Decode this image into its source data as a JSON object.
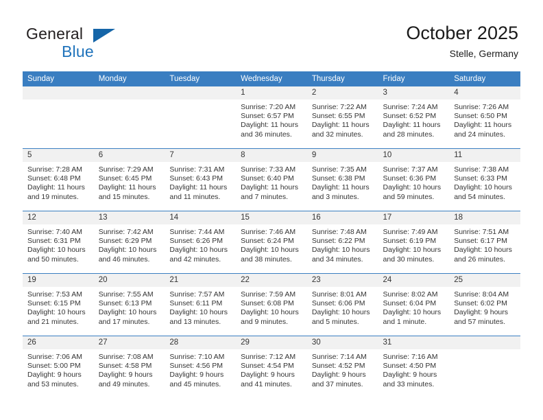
{
  "brand": {
    "name_part1": "General",
    "name_part2": "Blue",
    "triangle_color": "#1565a8",
    "blue_color": "#1f73bb"
  },
  "header": {
    "title": "October 2025",
    "subtitle": "Stelle, Germany"
  },
  "colors": {
    "header_blue": "#3a7ec1",
    "daynum_band": "#f1f1f1",
    "text": "#333333"
  },
  "weekdays": [
    "Sunday",
    "Monday",
    "Tuesday",
    "Wednesday",
    "Thursday",
    "Friday",
    "Saturday"
  ],
  "labels": {
    "sunrise_prefix": "Sunrise:",
    "sunset_prefix": "Sunset:",
    "daylight_prefix": "Daylight:"
  },
  "weeks": [
    [
      {
        "day": "",
        "empty": true
      },
      {
        "day": "",
        "empty": true
      },
      {
        "day": "",
        "empty": true
      },
      {
        "day": "1",
        "sunrise": "Sunrise: 7:20 AM",
        "sunset": "Sunset: 6:57 PM",
        "daylight": "Daylight: 11 hours and 36 minutes."
      },
      {
        "day": "2",
        "sunrise": "Sunrise: 7:22 AM",
        "sunset": "Sunset: 6:55 PM",
        "daylight": "Daylight: 11 hours and 32 minutes."
      },
      {
        "day": "3",
        "sunrise": "Sunrise: 7:24 AM",
        "sunset": "Sunset: 6:52 PM",
        "daylight": "Daylight: 11 hours and 28 minutes."
      },
      {
        "day": "4",
        "sunrise": "Sunrise: 7:26 AM",
        "sunset": "Sunset: 6:50 PM",
        "daylight": "Daylight: 11 hours and 24 minutes."
      }
    ],
    [
      {
        "day": "5",
        "sunrise": "Sunrise: 7:28 AM",
        "sunset": "Sunset: 6:48 PM",
        "daylight": "Daylight: 11 hours and 19 minutes."
      },
      {
        "day": "6",
        "sunrise": "Sunrise: 7:29 AM",
        "sunset": "Sunset: 6:45 PM",
        "daylight": "Daylight: 11 hours and 15 minutes."
      },
      {
        "day": "7",
        "sunrise": "Sunrise: 7:31 AM",
        "sunset": "Sunset: 6:43 PM",
        "daylight": "Daylight: 11 hours and 11 minutes."
      },
      {
        "day": "8",
        "sunrise": "Sunrise: 7:33 AM",
        "sunset": "Sunset: 6:40 PM",
        "daylight": "Daylight: 11 hours and 7 minutes."
      },
      {
        "day": "9",
        "sunrise": "Sunrise: 7:35 AM",
        "sunset": "Sunset: 6:38 PM",
        "daylight": "Daylight: 11 hours and 3 minutes."
      },
      {
        "day": "10",
        "sunrise": "Sunrise: 7:37 AM",
        "sunset": "Sunset: 6:36 PM",
        "daylight": "Daylight: 10 hours and 59 minutes."
      },
      {
        "day": "11",
        "sunrise": "Sunrise: 7:38 AM",
        "sunset": "Sunset: 6:33 PM",
        "daylight": "Daylight: 10 hours and 54 minutes."
      }
    ],
    [
      {
        "day": "12",
        "sunrise": "Sunrise: 7:40 AM",
        "sunset": "Sunset: 6:31 PM",
        "daylight": "Daylight: 10 hours and 50 minutes."
      },
      {
        "day": "13",
        "sunrise": "Sunrise: 7:42 AM",
        "sunset": "Sunset: 6:29 PM",
        "daylight": "Daylight: 10 hours and 46 minutes."
      },
      {
        "day": "14",
        "sunrise": "Sunrise: 7:44 AM",
        "sunset": "Sunset: 6:26 PM",
        "daylight": "Daylight: 10 hours and 42 minutes."
      },
      {
        "day": "15",
        "sunrise": "Sunrise: 7:46 AM",
        "sunset": "Sunset: 6:24 PM",
        "daylight": "Daylight: 10 hours and 38 minutes."
      },
      {
        "day": "16",
        "sunrise": "Sunrise: 7:48 AM",
        "sunset": "Sunset: 6:22 PM",
        "daylight": "Daylight: 10 hours and 34 minutes."
      },
      {
        "day": "17",
        "sunrise": "Sunrise: 7:49 AM",
        "sunset": "Sunset: 6:19 PM",
        "daylight": "Daylight: 10 hours and 30 minutes."
      },
      {
        "day": "18",
        "sunrise": "Sunrise: 7:51 AM",
        "sunset": "Sunset: 6:17 PM",
        "daylight": "Daylight: 10 hours and 26 minutes."
      }
    ],
    [
      {
        "day": "19",
        "sunrise": "Sunrise: 7:53 AM",
        "sunset": "Sunset: 6:15 PM",
        "daylight": "Daylight: 10 hours and 21 minutes."
      },
      {
        "day": "20",
        "sunrise": "Sunrise: 7:55 AM",
        "sunset": "Sunset: 6:13 PM",
        "daylight": "Daylight: 10 hours and 17 minutes."
      },
      {
        "day": "21",
        "sunrise": "Sunrise: 7:57 AM",
        "sunset": "Sunset: 6:11 PM",
        "daylight": "Daylight: 10 hours and 13 minutes."
      },
      {
        "day": "22",
        "sunrise": "Sunrise: 7:59 AM",
        "sunset": "Sunset: 6:08 PM",
        "daylight": "Daylight: 10 hours and 9 minutes."
      },
      {
        "day": "23",
        "sunrise": "Sunrise: 8:01 AM",
        "sunset": "Sunset: 6:06 PM",
        "daylight": "Daylight: 10 hours and 5 minutes."
      },
      {
        "day": "24",
        "sunrise": "Sunrise: 8:02 AM",
        "sunset": "Sunset: 6:04 PM",
        "daylight": "Daylight: 10 hours and 1 minute."
      },
      {
        "day": "25",
        "sunrise": "Sunrise: 8:04 AM",
        "sunset": "Sunset: 6:02 PM",
        "daylight": "Daylight: 9 hours and 57 minutes."
      }
    ],
    [
      {
        "day": "26",
        "sunrise": "Sunrise: 7:06 AM",
        "sunset": "Sunset: 5:00 PM",
        "daylight": "Daylight: 9 hours and 53 minutes."
      },
      {
        "day": "27",
        "sunrise": "Sunrise: 7:08 AM",
        "sunset": "Sunset: 4:58 PM",
        "daylight": "Daylight: 9 hours and 49 minutes."
      },
      {
        "day": "28",
        "sunrise": "Sunrise: 7:10 AM",
        "sunset": "Sunset: 4:56 PM",
        "daylight": "Daylight: 9 hours and 45 minutes."
      },
      {
        "day": "29",
        "sunrise": "Sunrise: 7:12 AM",
        "sunset": "Sunset: 4:54 PM",
        "daylight": "Daylight: 9 hours and 41 minutes."
      },
      {
        "day": "30",
        "sunrise": "Sunrise: 7:14 AM",
        "sunset": "Sunset: 4:52 PM",
        "daylight": "Daylight: 9 hours and 37 minutes."
      },
      {
        "day": "31",
        "sunrise": "Sunrise: 7:16 AM",
        "sunset": "Sunset: 4:50 PM",
        "daylight": "Daylight: 9 hours and 33 minutes."
      },
      {
        "day": "",
        "empty": true
      }
    ]
  ]
}
